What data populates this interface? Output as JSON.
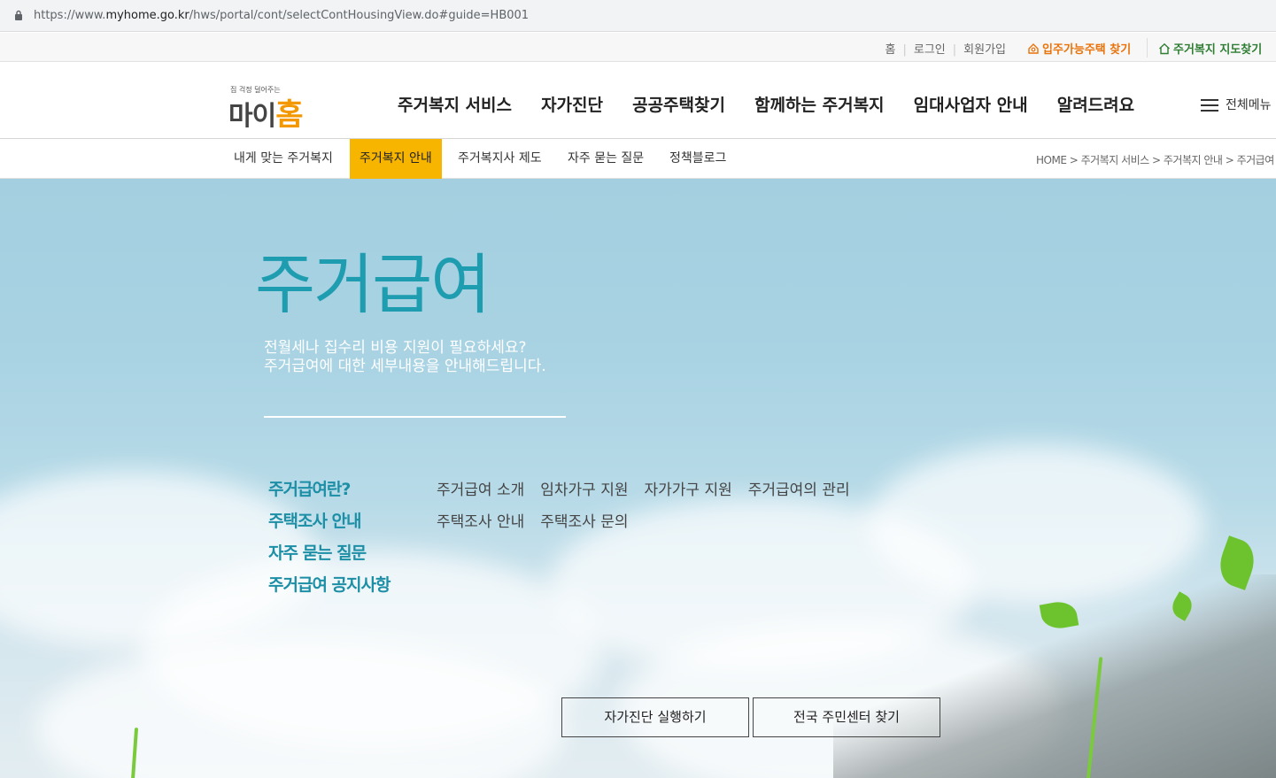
{
  "browser": {
    "url_prefix": "https://www.",
    "url_host": "myhome.go.kr",
    "url_path": "/hws/portal/cont/selectContHousingView.do#guide=HB001"
  },
  "utility": {
    "home": "홈",
    "login": "로그인",
    "signup": "회원가입",
    "find_housing": "입주가능주택 찾기",
    "map_search": "주거복지 지도찾기"
  },
  "logo": {
    "tagline": "집 걱정 덜어주는",
    "name_prefix": "마이",
    "name_suffix": "홈"
  },
  "gnb": [
    "주거복지 서비스",
    "자가진단",
    "공공주택찾기",
    "함께하는 주거복지",
    "임대사업자 안내",
    "알려드려요"
  ],
  "all_menu": "전체메뉴",
  "snb": [
    "내게 맞는 주거복지",
    "주거복지 안내",
    "주거복지사 제도",
    "자주 묻는 질문",
    "정책블로그"
  ],
  "breadcrumb": "HOME > 주거복지 서비스 > 주거복지 안내 > 주거급여",
  "hero": {
    "title": "주거급여",
    "desc_line1": "전월세나 집수리 비용 지원이 필요하세요?",
    "desc_line2": "주거급여에 대한 세부내용을 안내해드립니다."
  },
  "menu": [
    {
      "category": "주거급여란?",
      "items": [
        "주거급여 소개",
        "임차가구 지원",
        "자가가구 지원",
        "주거급여의 관리"
      ]
    },
    {
      "category": "주택조사 안내",
      "items": [
        "주택조사 안내",
        "주택조사 문의"
      ]
    },
    {
      "category": "자주 묻는 질문",
      "items": []
    },
    {
      "category": "주거급여 공지사항",
      "items": []
    }
  ],
  "buttons": {
    "self_check": "자가진단 실행하기",
    "center_search": "전국 주민센터 찾기"
  },
  "colors": {
    "accent_yellow": "#f7b500",
    "title_teal": "#1e9db0",
    "category_teal": "#1c8fa6",
    "orange": "#e8730a",
    "green": "#2e7d32"
  }
}
